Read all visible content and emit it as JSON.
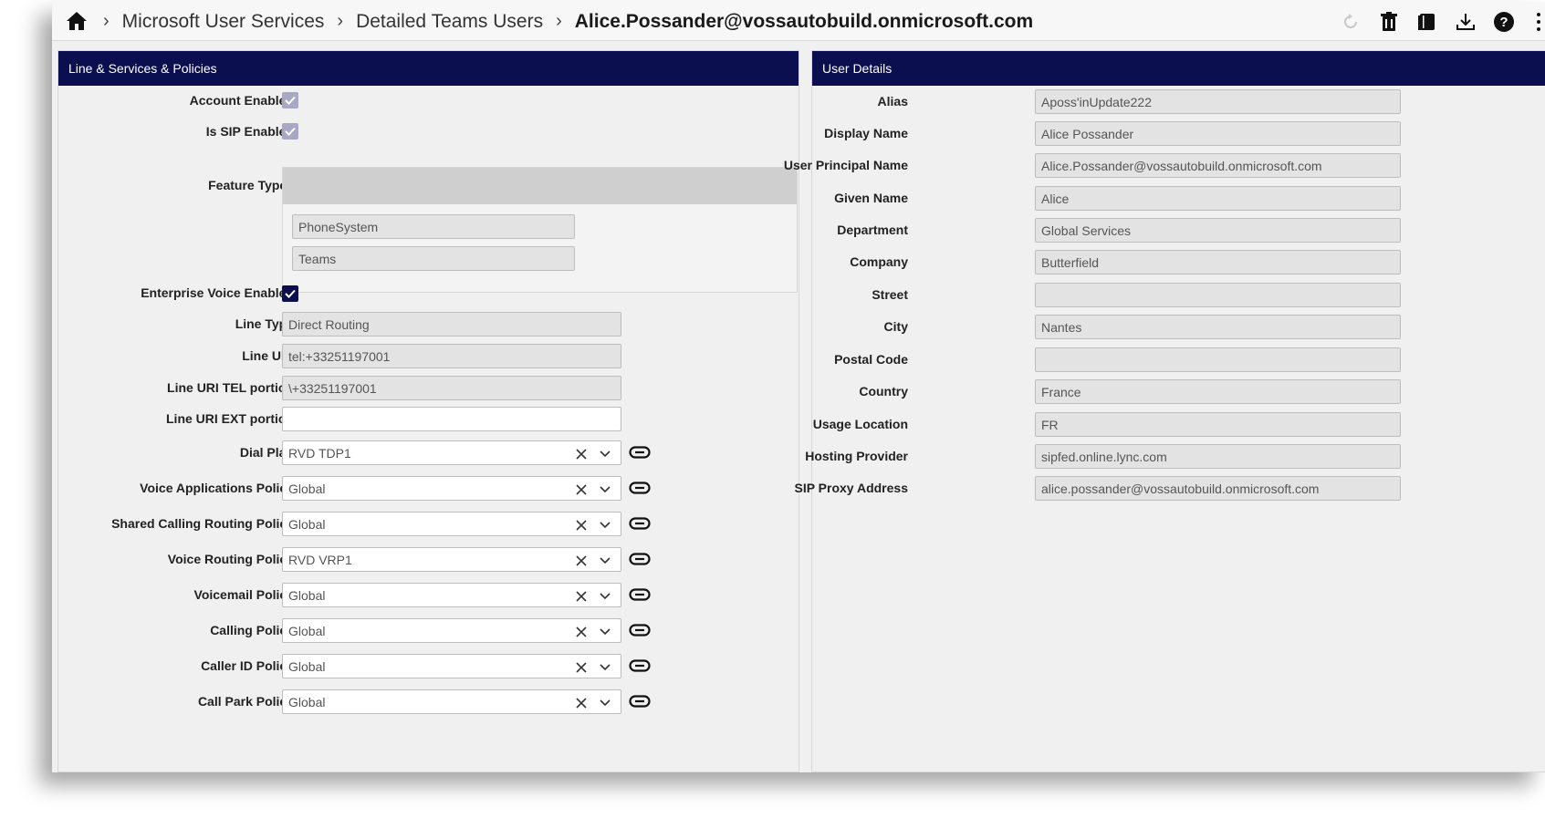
{
  "breadcrumb": {
    "items": [
      "Microsoft User Services",
      "Detailed Teams Users"
    ],
    "current": "Alice.Possander@vossautobuild.onmicrosoft.com"
  },
  "toolbar": {
    "icons": [
      "refresh-icon",
      "delete-icon",
      "book-icon",
      "download-icon",
      "help-icon",
      "more-vertical-icon"
    ]
  },
  "left_panel": {
    "title": "Line & Services & Policies",
    "account_enabled": {
      "label": "Account Enabled",
      "checked": true
    },
    "is_sip_enabled": {
      "label": "Is SIP Enabled",
      "checked": true
    },
    "feature_types": {
      "label": "Feature Types",
      "items": [
        "PhoneSystem",
        "Teams"
      ]
    },
    "enterprise_voice_enabled": {
      "label": "Enterprise Voice Enabled",
      "checked": true
    },
    "line_type": {
      "label": "Line Type",
      "value": "Direct Routing"
    },
    "line_uri": {
      "label": "Line URI",
      "value": "tel:+33251197001"
    },
    "line_uri_tel": {
      "label": "Line URI TEL portion",
      "value": "\\+33251197001"
    },
    "line_uri_ext": {
      "label": "Line URI EXT portion",
      "value": ""
    },
    "policies": [
      {
        "label": "Dial Plan",
        "value": "RVD TDP1"
      },
      {
        "label": "Voice Applications Policy",
        "value": "Global"
      },
      {
        "label": "Shared Calling Routing Policy",
        "value": "Global"
      },
      {
        "label": "Voice Routing Policy",
        "value": "RVD VRP1"
      },
      {
        "label": "Voicemail Policy",
        "value": "Global"
      },
      {
        "label": "Calling Policy",
        "value": "Global"
      },
      {
        "label": "Caller ID Policy",
        "value": "Global"
      },
      {
        "label": "Call Park Policy",
        "value": "Global"
      }
    ]
  },
  "right_panel": {
    "title": "User Details",
    "fields": [
      {
        "label": "Alias",
        "value": "Aposs'inUpdate222"
      },
      {
        "label": "Display Name",
        "value": "Alice Possander"
      },
      {
        "label": "User Principal Name",
        "value": "Alice.Possander@vossautobuild.onmicrosoft.com"
      },
      {
        "label": "Given Name",
        "value": "Alice"
      },
      {
        "label": "Department",
        "value": "Global Services"
      },
      {
        "label": "Company",
        "value": "Butterfield"
      },
      {
        "label": "Street",
        "value": ""
      },
      {
        "label": "City",
        "value": "Nantes"
      },
      {
        "label": "Postal Code",
        "value": ""
      },
      {
        "label": "Country",
        "value": "France"
      },
      {
        "label": "Usage Location",
        "value": "FR"
      },
      {
        "label": "Hosting Provider",
        "value": "sipfed.online.lync.com"
      },
      {
        "label": "SIP Proxy Address",
        "value": "alice.possander@vossautobuild.onmicrosoft.com"
      }
    ]
  },
  "colors": {
    "header_bg": "#0c0f4f",
    "checkbox_disabled": "#a8a8c6",
    "checkbox_active": "#0c0f4f"
  }
}
